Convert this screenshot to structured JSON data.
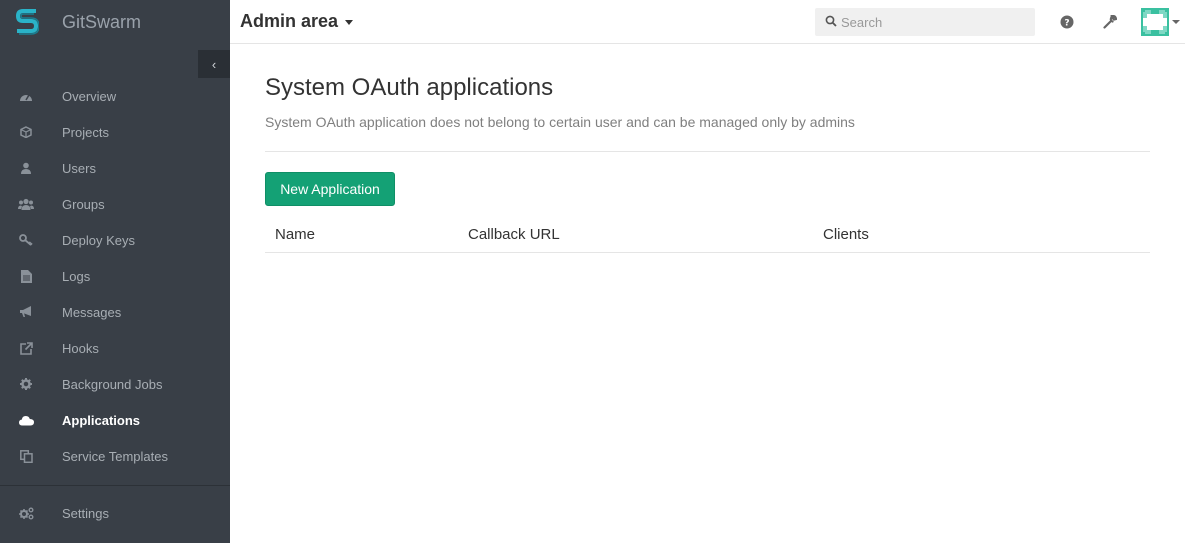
{
  "sidebar": {
    "brand": "GitSwarm",
    "collapse_glyph": "‹",
    "items": [
      {
        "label": "Overview",
        "icon": "dashboard-icon"
      },
      {
        "label": "Projects",
        "icon": "cube-icon"
      },
      {
        "label": "Users",
        "icon": "user-icon"
      },
      {
        "label": "Groups",
        "icon": "users-icon"
      },
      {
        "label": "Deploy Keys",
        "icon": "key-icon"
      },
      {
        "label": "Logs",
        "icon": "file-icon"
      },
      {
        "label": "Messages",
        "icon": "bullhorn-icon"
      },
      {
        "label": "Hooks",
        "icon": "external-link-icon"
      },
      {
        "label": "Background Jobs",
        "icon": "gear-icon"
      },
      {
        "label": "Applications",
        "icon": "cloud-icon",
        "active": true
      },
      {
        "label": "Service Templates",
        "icon": "copy-icon"
      },
      {
        "label": "Settings",
        "icon": "cogs-icon"
      }
    ]
  },
  "header": {
    "title": "Admin area",
    "search_placeholder": "Search"
  },
  "main": {
    "title": "System OAuth applications",
    "description": "System OAuth application does not belong to certain user and can be managed only by admins",
    "new_button": "New Application",
    "table": {
      "columns": [
        "Name",
        "Callback URL",
        "Clients"
      ],
      "rows": []
    }
  },
  "colors": {
    "sidebar_bg": "#393f47",
    "accent_green": "#14a175",
    "brand_teal": "#2ab3c8"
  }
}
